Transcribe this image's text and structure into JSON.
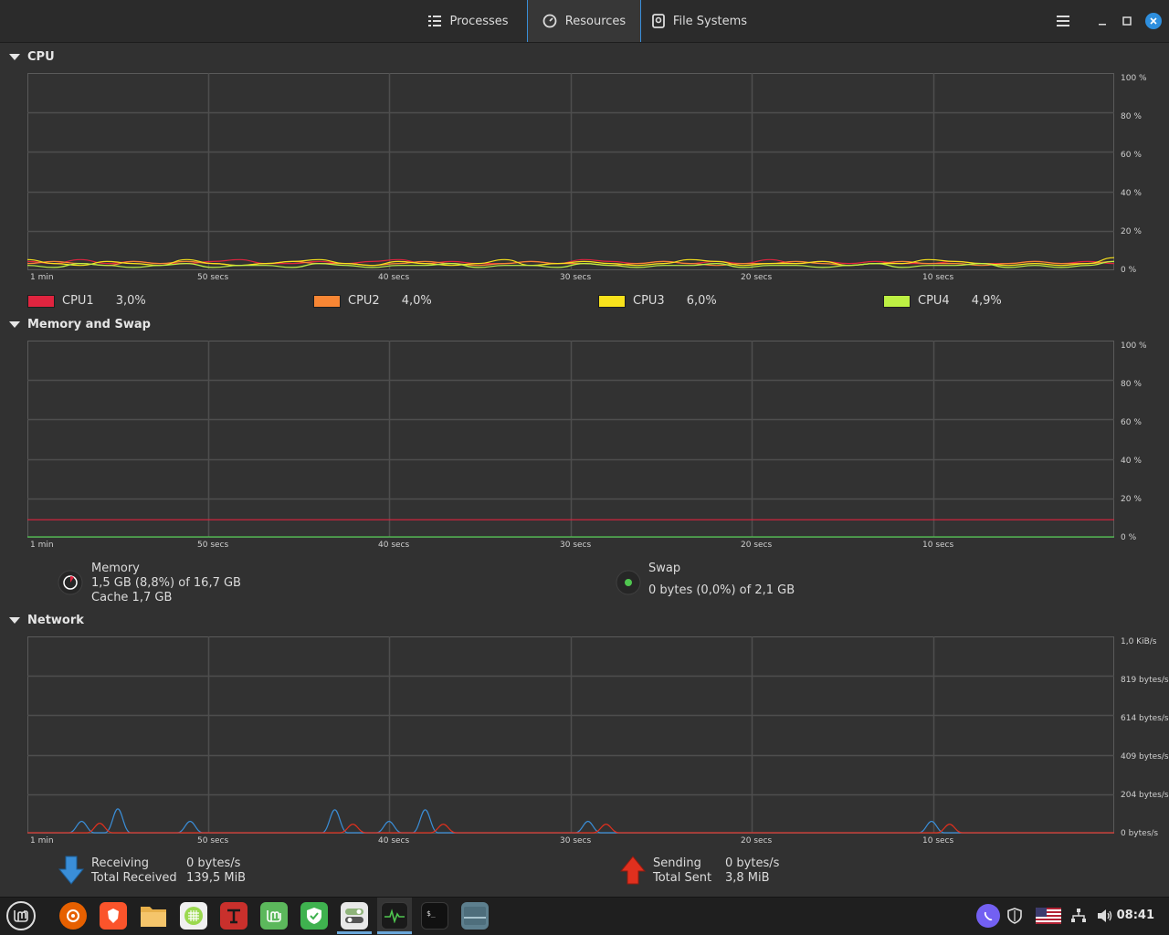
{
  "header": {
    "tabs": [
      {
        "label": "Processes",
        "icon": "list-icon"
      },
      {
        "label": "Resources",
        "icon": "gauge-icon"
      },
      {
        "label": "File Systems",
        "icon": "disk-icon"
      }
    ],
    "active_tab": "Resources",
    "controls": [
      "menu-icon",
      "minimize-icon",
      "maximize-icon",
      "close-icon"
    ],
    "accent": "#3a8ed8"
  },
  "cpu": {
    "title": "CPU",
    "y_ticks": [
      "100 %",
      "80 %",
      "60 %",
      "40 %",
      "20 %",
      "0 %"
    ],
    "x_ticks": [
      "1 min",
      "50 secs",
      "40 secs",
      "30 secs",
      "20 secs",
      "10 secs"
    ],
    "legend": [
      {
        "name": "CPU1",
        "value": "3,0%",
        "color": "#e0243f"
      },
      {
        "name": "CPU2",
        "value": "4,0%",
        "color": "#f78634"
      },
      {
        "name": "CPU3",
        "value": "6,0%",
        "color": "#f8e21c"
      },
      {
        "name": "CPU4",
        "value": "4,9%",
        "color": "#bdf043"
      }
    ]
  },
  "memory": {
    "title": "Memory and Swap",
    "y_ticks": [
      "100 %",
      "80 %",
      "60 %",
      "40 %",
      "20 %",
      "0 %"
    ],
    "x_ticks": [
      "1 min",
      "50 secs",
      "40 secs",
      "30 secs",
      "20 secs",
      "10 secs"
    ],
    "memory_label": "Memory",
    "memory_usage": "1,5 GB (8,8%) of 16,7 GB",
    "memory_cache": "Cache 1,7 GB",
    "memory_color": "#e0243f",
    "swap_label": "Swap",
    "swap_usage": "0 bytes (0,0%) of 2,1 GB",
    "swap_color": "#4fc64f"
  },
  "network": {
    "title": "Network",
    "y_ticks": [
      "1,0 KiB/s",
      "819 bytes/s",
      "614 bytes/s",
      "409 bytes/s",
      "204 bytes/s",
      "0 bytes/s"
    ],
    "x_ticks": [
      "1 min",
      "50 secs",
      "40 secs",
      "30 secs",
      "20 secs",
      "10 secs"
    ],
    "receiving_label": "Receiving",
    "receiving_value": "0 bytes/s",
    "total_received_label": "Total Received",
    "total_received_value": "139,5 MiB",
    "sending_label": "Sending",
    "sending_value": "0 bytes/s",
    "total_sent_label": "Total Sent",
    "total_sent_value": "3,8 MiB",
    "receiving_color": "#3a8ed8",
    "sending_color": "#e0301e"
  },
  "chart_data": [
    {
      "type": "line",
      "title": "CPU",
      "x_axis": "time",
      "x_ticks": [
        "1 min",
        "50 secs",
        "40 secs",
        "30 secs",
        "20 secs",
        "10 secs"
      ],
      "ylim": [
        0,
        100
      ],
      "y_unit": "%",
      "series": [
        {
          "name": "CPU1",
          "values": [
            4,
            3,
            5,
            3,
            4,
            3,
            3,
            4,
            5,
            3,
            3,
            4,
            3,
            4,
            5,
            3,
            4,
            3,
            3,
            4,
            3,
            5,
            4,
            3,
            4,
            3,
            4,
            3,
            5,
            3,
            4,
            3,
            4,
            3,
            3,
            4,
            3,
            3,
            4,
            3,
            4,
            3
          ]
        },
        {
          "name": "CPU2",
          "values": [
            3,
            4,
            3,
            2,
            4,
            3,
            4,
            3,
            2,
            3,
            4,
            3,
            3,
            2,
            3,
            4,
            3,
            2,
            3,
            4,
            3,
            3,
            2,
            3,
            4,
            3,
            2,
            3,
            3,
            4,
            3,
            2,
            3,
            4,
            3,
            3,
            2,
            3,
            4,
            3,
            3,
            4
          ]
        },
        {
          "name": "CPU3",
          "values": [
            5,
            3,
            2,
            4,
            3,
            2,
            5,
            3,
            2,
            3,
            4,
            5,
            3,
            2,
            4,
            3,
            2,
            3,
            5,
            2,
            3,
            4,
            3,
            2,
            3,
            5,
            4,
            2,
            3,
            3,
            4,
            2,
            3,
            3,
            5,
            4,
            3,
            2,
            3,
            2,
            3,
            6
          ]
        },
        {
          "name": "CPU4",
          "values": [
            2,
            1,
            3,
            2,
            1,
            2,
            3,
            1,
            2,
            2,
            1,
            3,
            2,
            1,
            2,
            2,
            3,
            1,
            2,
            2,
            1,
            3,
            2,
            1,
            2,
            2,
            3,
            1,
            2,
            2,
            1,
            2,
            3,
            1,
            2,
            2,
            3,
            1,
            2,
            1,
            2,
            4
          ]
        }
      ]
    },
    {
      "type": "line",
      "title": "Memory and Swap",
      "x_ticks": [
        "1 min",
        "50 secs",
        "40 secs",
        "30 secs",
        "20 secs",
        "10 secs"
      ],
      "ylim": [
        0,
        100
      ],
      "y_unit": "%",
      "series": [
        {
          "name": "Memory",
          "values": [
            8.8,
            8.8
          ]
        },
        {
          "name": "Swap",
          "values": [
            0,
            0
          ]
        }
      ]
    },
    {
      "type": "line",
      "title": "Network",
      "x_ticks": [
        "1 min",
        "50 secs",
        "40 secs",
        "30 secs",
        "20 secs",
        "10 secs"
      ],
      "ylim": [
        0,
        1024
      ],
      "y_unit": "bytes/s",
      "series": [
        {
          "name": "Receiving",
          "peaks": [
            [
              57,
              60
            ],
            [
              55,
              125
            ],
            [
              51,
              60
            ],
            [
              43,
              120
            ],
            [
              40,
              60
            ],
            [
              38,
              120
            ],
            [
              29,
              60
            ],
            [
              10,
              60
            ]
          ]
        },
        {
          "name": "Sending",
          "peaks": [
            [
              56,
              50
            ],
            [
              42,
              45
            ],
            [
              37,
              45
            ],
            [
              28,
              45
            ],
            [
              9,
              45
            ]
          ]
        }
      ]
    }
  ],
  "taskbar": {
    "apps": [
      {
        "name": "mint-menu-icon",
        "color": "#2b2b2b"
      },
      {
        "name": "firefox-icon",
        "color": "#e66000"
      },
      {
        "name": "brave-icon",
        "color": "#fb542b"
      },
      {
        "name": "files-icon",
        "color": "#e8b04a"
      },
      {
        "name": "grid-app-icon",
        "color": "#9bd94f"
      },
      {
        "name": "text-editor-icon",
        "color": "#c9302c"
      },
      {
        "name": "mint-update-icon",
        "color": "#5cb85c"
      },
      {
        "name": "vpn-shield-icon",
        "color": "#3fb24f"
      },
      {
        "name": "settings-toggle-icon",
        "color": "#8fb47a"
      },
      {
        "name": "system-monitor-icon",
        "color": "#1a1a1a"
      },
      {
        "name": "terminal-icon",
        "color": "#111111"
      },
      {
        "name": "window-icon",
        "color": "#5d7f8e"
      }
    ],
    "tray": [
      "viber-icon",
      "shield-icon",
      "us-flag-icon",
      "network-icon",
      "volume-icon"
    ],
    "clock": "08:41"
  }
}
